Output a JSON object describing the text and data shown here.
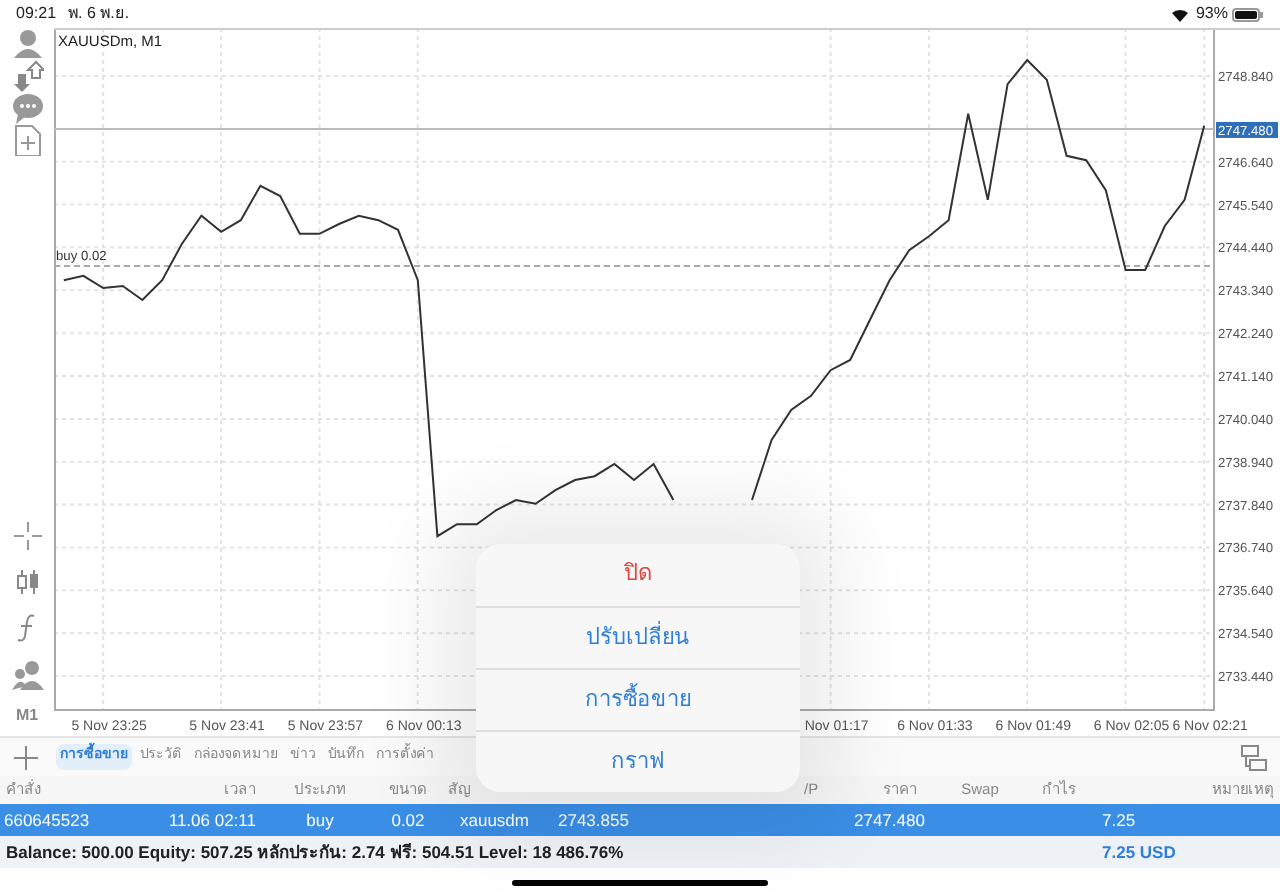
{
  "status_bar": {
    "time": "09:21",
    "date": "พ. 6 พ.ย.",
    "battery": "93%"
  },
  "toolbar": {
    "timeframe": "M1"
  },
  "chart": {
    "chart_data": {
      "type": "line",
      "title": "XAUUSDm, M1",
      "grid": true,
      "categories": [
        null,
        null,
        "5 Nov 23:25",
        null,
        null,
        null,
        null,
        null,
        "5 Nov 23:41",
        null,
        null,
        null,
        null,
        "5 Nov 23:57",
        null,
        null,
        null,
        null,
        "6 Nov 00:13",
        null,
        null,
        null,
        null,
        null,
        null,
        null,
        null,
        null,
        null,
        null,
        null,
        null,
        null,
        null,
        null,
        null,
        null,
        null,
        null,
        "Nov 01:17",
        null,
        null,
        null,
        null,
        "6 Nov 01:33",
        null,
        null,
        null,
        null,
        "6 Nov 01:49",
        null,
        null,
        null,
        null,
        "6 Nov 02:05",
        null,
        null,
        null,
        "6 Nov 02:21"
      ],
      "series": [
        {
          "color": "#333333",
          "values": [
            2743.6,
            2743.71,
            2743.4,
            2743.45,
            2743.09,
            2743.6,
            2744.53,
            2745.25,
            2744.84,
            2745.14,
            2746.02,
            2745.76,
            2744.79,
            2744.79,
            2745.04,
            2745.25,
            2745.14,
            2744.89,
            2743.6,
            2737.03,
            2737.34,
            2737.34,
            2737.7,
            2737.96,
            2737.86,
            2738.21,
            2738.47,
            2738.57,
            2738.88,
            2738.47,
            2738.88,
            2737.96,
            null,
            null,
            null,
            2737.96,
            2739.5,
            2740.27,
            2740.63,
            2741.29,
            2741.55,
            2742.58,
            2743.6,
            2744.37,
            2744.73,
            2745.14,
            2747.87,
            2745.66,
            2748.63,
            2749.25,
            2748.74,
            2746.79,
            2746.68,
            2745.91,
            2743.86,
            2743.86,
            2744.99,
            2745.66,
            2747.56
          ]
        }
      ],
      "ylim": [
        2732.57,
        2750.07
      ],
      "yticks": [
        {
          "value": 2733.44,
          "label": "2733.440"
        },
        {
          "value": 2734.54,
          "label": "2734.540"
        },
        {
          "value": 2735.64,
          "label": "2735.640"
        },
        {
          "value": 2736.74,
          "label": "2736.740"
        },
        {
          "value": 2737.84,
          "label": "2737.840"
        },
        {
          "value": 2738.94,
          "label": "2738.940"
        },
        {
          "value": 2740.04,
          "label": "2740.040"
        },
        {
          "value": 2741.14,
          "label": "2741.140"
        },
        {
          "value": 2742.24,
          "label": "2742.240"
        },
        {
          "value": 2743.34,
          "label": "2743.340"
        },
        {
          "value": 2744.44,
          "label": "2744.440"
        },
        {
          "value": 2745.54,
          "label": "2745.540"
        },
        {
          "value": 2746.64,
          "label": "2746.640"
        },
        {
          "value": 2748.84,
          "label": "2748.840"
        }
      ],
      "ref_lines": [
        {
          "axis": "y",
          "value": 2743.96,
          "label": "buy 0.02"
        },
        {
          "axis": "y",
          "value": 2747.48,
          "label": "2747.480"
        }
      ]
    }
  },
  "context_menu": [
    {
      "label": "ปิด",
      "kind": "destructive"
    },
    {
      "label": "ปรับเปลี่ยน",
      "kind": "default"
    },
    {
      "label": "การซื้อขาย",
      "kind": "default"
    },
    {
      "label": "กราฟ",
      "kind": "default"
    }
  ],
  "tabs": [
    {
      "label": "การซื้อขาย",
      "selected": true
    },
    {
      "label": "ประวัติ",
      "selected": false
    },
    {
      "label": "กล่องจดหมาย",
      "selected": false
    },
    {
      "label": "ข่าว",
      "selected": false
    },
    {
      "label": "บันทึก",
      "selected": false
    },
    {
      "label": "การตั้งค่า",
      "selected": false
    }
  ],
  "table": {
    "columns": [
      "คำสั่ง",
      "เวลา",
      "ประเภท",
      "ขนาด",
      "สัญ",
      "/P",
      "ราคา",
      "Swap",
      "กำไร",
      "หมายเหตุ"
    ],
    "rows": [
      {
        "selected": true,
        "cells": [
          "660645523",
          "11.06 02:11",
          "buy",
          "0.02",
          "xauusdm",
          "2743.855",
          "2747.480",
          "7.25"
        ]
      }
    ]
  },
  "summary": {
    "text": "Balance: 500.00 Equity: 507.25 หลักประกัน: 2.74 ฟรี: 504.51 Level: 18 486.76%",
    "profit": "7.25 USD"
  }
}
